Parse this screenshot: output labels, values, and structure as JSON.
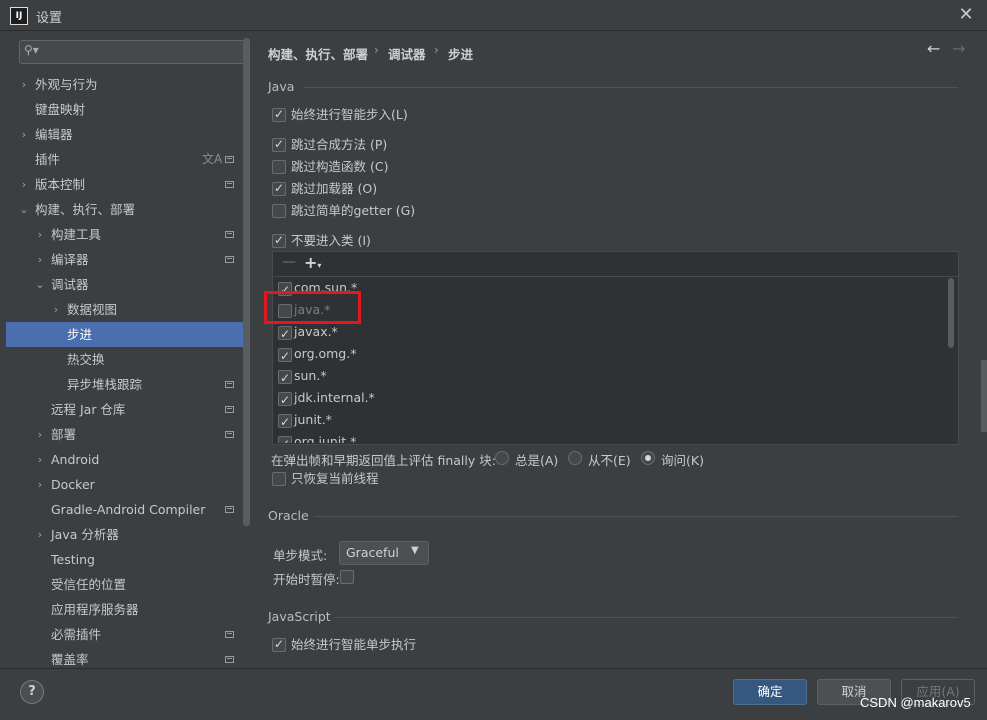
{
  "window": {
    "logo_text": "IJ",
    "title": "设置"
  },
  "search": {
    "placeholder": ""
  },
  "sidebar": {
    "items": [
      {
        "label": "外观与行为"
      },
      {
        "label": "键盘映射"
      },
      {
        "label": "编辑器"
      },
      {
        "label": "插件"
      },
      {
        "label": "版本控制"
      },
      {
        "label": "构建、执行、部署"
      },
      {
        "label": "构建工具"
      },
      {
        "label": "编译器"
      },
      {
        "label": "调试器"
      },
      {
        "label": "数据视图"
      },
      {
        "label": "步进"
      },
      {
        "label": "热交换"
      },
      {
        "label": "异步堆栈跟踪"
      },
      {
        "label": "远程 Jar 仓库"
      },
      {
        "label": "部署"
      },
      {
        "label": "Android"
      },
      {
        "label": "Docker"
      },
      {
        "label": "Gradle-Android Compiler"
      },
      {
        "label": "Java 分析器"
      },
      {
        "label": "Testing"
      },
      {
        "label": "受信任的位置"
      },
      {
        "label": "应用程序服务器"
      },
      {
        "label": "必需插件"
      },
      {
        "label": "覆盖率"
      }
    ]
  },
  "breadcrumb": {
    "c1": "构建、执行、部署",
    "c2": "调试器",
    "c3": "步进",
    "sep": "›"
  },
  "java": {
    "title": "Java",
    "smart_step": "始终进行智能步入(L)",
    "skip_synthetic": "跳过合成方法 (P)",
    "skip_constructors": "跳过构造函数 (C)",
    "skip_class_loaders": "跳过加载器 (O)",
    "skip_getters": "跳过简单的getter (G)",
    "dont_step_into": "不要进入类 (I)",
    "classes": [
      {
        "name": "com.sun.*",
        "checked": true
      },
      {
        "name": "java.*",
        "checked": false
      },
      {
        "name": "javax.*",
        "checked": true
      },
      {
        "name": "org.omg.*",
        "checked": true
      },
      {
        "name": "sun.*",
        "checked": true
      },
      {
        "name": "jdk.internal.*",
        "checked": true
      },
      {
        "name": "junit.*",
        "checked": true
      },
      {
        "name": "org.junit.*",
        "checked": true
      }
    ],
    "finally_label": "在弹出帧和早期返回值上评估 finally 块:",
    "opt_always": "总是(A)",
    "opt_never": "从不(E)",
    "opt_ask": "询问(K)",
    "resume_only_current": "只恢复当前线程"
  },
  "oracle": {
    "title": "Oracle",
    "step_mode_label": "单步模式:",
    "step_mode_value": "Graceful",
    "pause_on_start": "开始时暂停:"
  },
  "javascript": {
    "title": "JavaScript",
    "smart_step": "始终进行智能单步执行"
  },
  "footer": {
    "help": "?",
    "ok": "确定",
    "cancel": "取消",
    "apply": "应用(A)"
  },
  "watermark": "CSDN @makarov5",
  "colors": {
    "selection": "#4b6eaf",
    "ok_button": "#365880",
    "highlight": "#e0191e",
    "background": "#3c3f41"
  }
}
